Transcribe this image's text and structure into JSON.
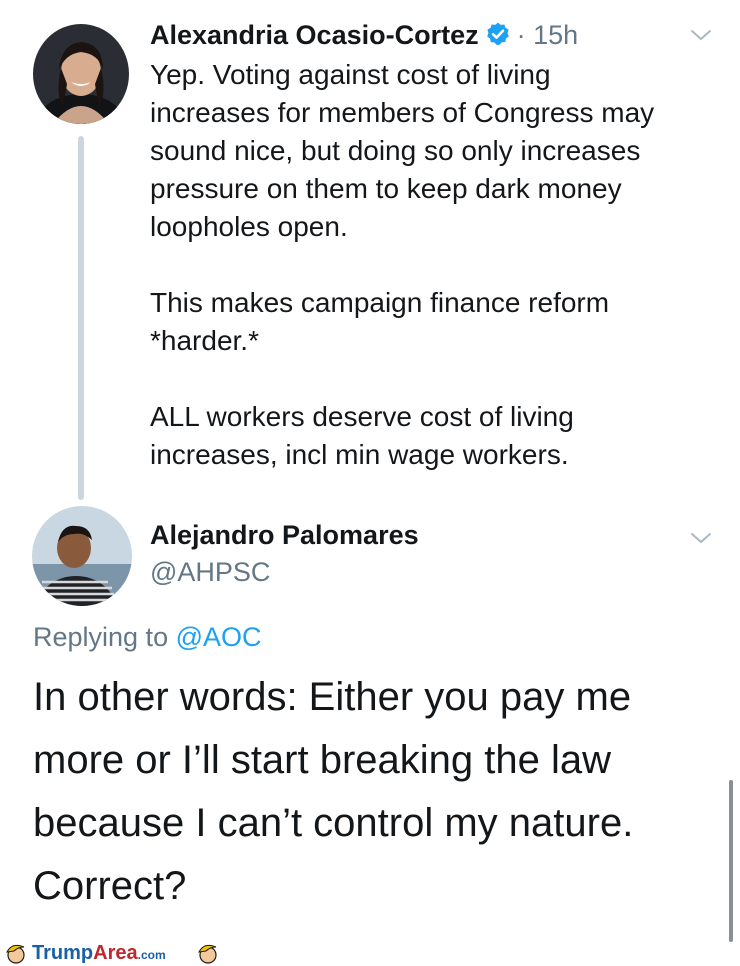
{
  "tweet1": {
    "author_name": "Alexandria Ocasio-Cortez",
    "time": "· 15h",
    "paragraphs": [
      "Yep. Voting against cost of living",
      "increases for members of Congress may",
      "sound nice, but doing so only increases",
      "pressure on them to keep dark money",
      "loopholes open."
    ],
    "paragraph2": [
      "This makes campaign finance reform",
      "*harder.*"
    ],
    "paragraph3": [
      "ALL workers deserve cost of living",
      "increases, incl min wage workers."
    ]
  },
  "tweet2": {
    "author_name": "Alejandro Palomares",
    "handle": "@AHPSC",
    "replying_prefix": "Replying to",
    "replying_mention": "@AOC",
    "body_lines": [
      "In other words: Either you pay me",
      "more or I’ll start breaking the law",
      "because I can’t control my nature.",
      "Correct?"
    ]
  },
  "watermark": {
    "part1": "Trump",
    "part2": "Area",
    "part3": ".com"
  },
  "colors": {
    "link": "#1da1f2",
    "muted": "#657786",
    "text": "#14171a"
  }
}
